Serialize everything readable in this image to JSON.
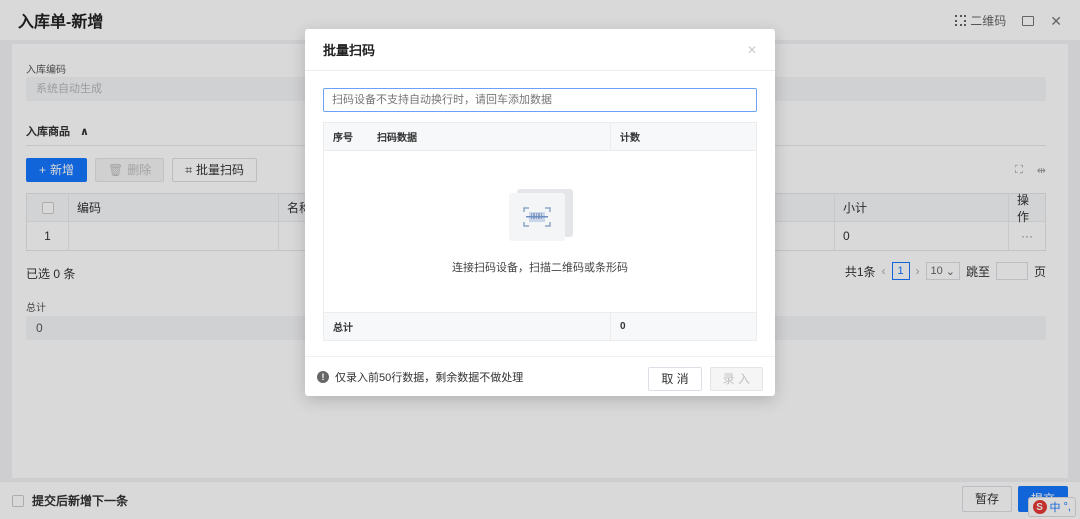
{
  "header": {
    "title": "入库单-新增",
    "qr_label": "二维码"
  },
  "form": {
    "code_label": "入库编码",
    "code_placeholder": "系统自动生成",
    "section_title": "入库商品",
    "section_toggle": "∧"
  },
  "toolbar": {
    "add_label": "新增",
    "delete_label": "删除",
    "batch_scan_label": "批量扫码"
  },
  "grid": {
    "columns": [
      "编码",
      "名称",
      "小计",
      "操作"
    ],
    "rows": [
      {
        "index": "1",
        "subtotal": "0",
        "action": "···"
      }
    ]
  },
  "selection": {
    "text": "已选 0 条"
  },
  "pagination": {
    "total": "共1条",
    "current_page": "1",
    "page_size": "10",
    "jump_label": "跳至",
    "page_unit": "页"
  },
  "totals": {
    "label": "总计",
    "value": "0"
  },
  "footer": {
    "continue_label": "提交后新增下一条",
    "save_draft_label": "暂存",
    "submit_label": "提交"
  },
  "ime": {
    "label": "中"
  },
  "modal": {
    "title": "批量扫码",
    "input_placeholder": "扫码设备不支持自动换行时，请回车添加数据",
    "columns": [
      "序号",
      "扫码数据",
      "计数"
    ],
    "empty_text": "连接扫码设备，扫描二维码或条形码",
    "total_label": "总计",
    "total_count": "0",
    "notice": "仅录入前50行数据，剩余数据不做处理",
    "cancel_label": "取 消",
    "enter_label": "录 入"
  },
  "colors": {
    "primary": "#1677ff"
  }
}
